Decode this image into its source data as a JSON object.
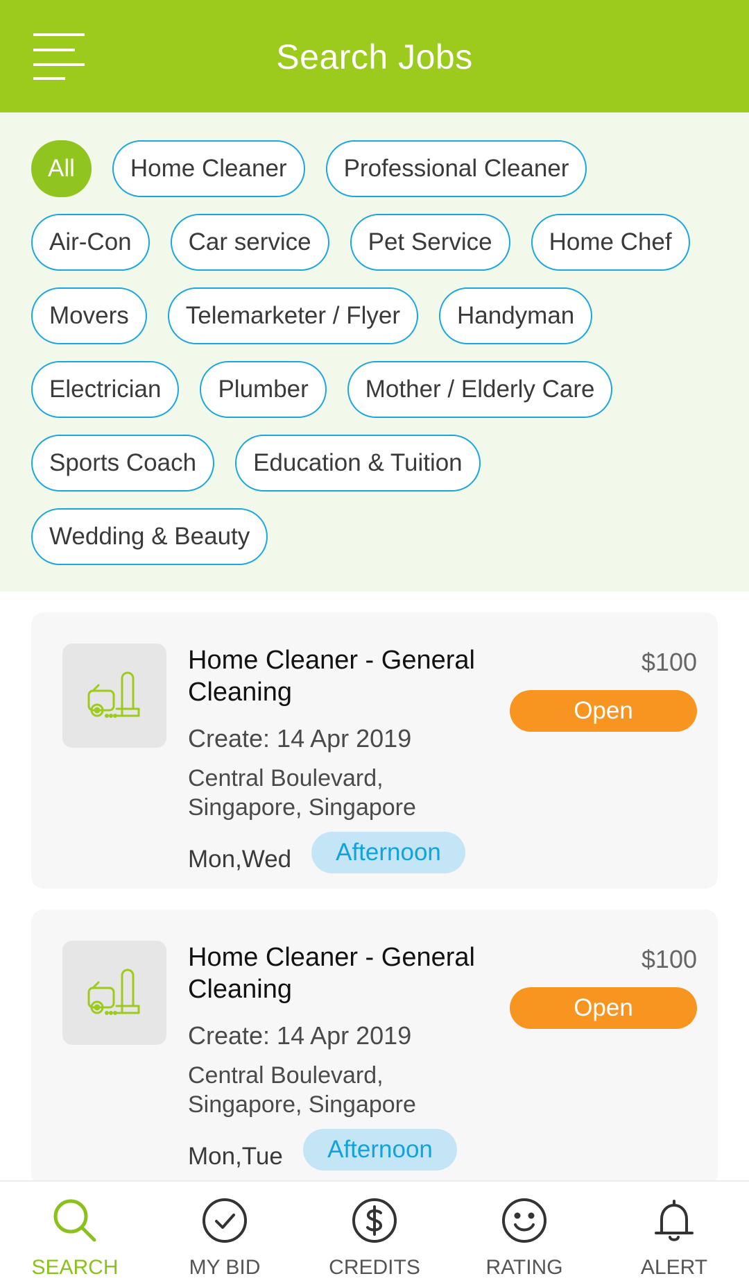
{
  "header": {
    "title": "Search Jobs",
    "menu_icon": "hamburger-menu-icon",
    "background_color": "#9dcb1d"
  },
  "filters": {
    "active": "All",
    "rows": [
      [
        "All",
        "Home Cleaner",
        "Professional Cleaner"
      ],
      [
        "Air-Con",
        "Car service",
        "Pet Service",
        "Home Chef"
      ],
      [
        "Movers",
        "Telemarketer / Flyer",
        "Handyman"
      ],
      [
        "Electrician",
        "Plumber",
        "Mother / Elderly Care"
      ],
      [
        "Sports Coach",
        "Education & Tuition"
      ],
      [
        "Wedding & Beauty"
      ]
    ],
    "accent_color": "#1aa7de",
    "active_color": "#90c41f"
  },
  "jobs": [
    {
      "icon": "vacuum-cleaner-icon",
      "title": "Home Cleaner - General Cleaning",
      "created": "Create: 14 Apr 2019",
      "location": "Central Boulevard, Singapore, Singapore",
      "days": "Mon,Wed",
      "time": "Afternoon",
      "price": "$100",
      "status": "Open"
    },
    {
      "icon": "vacuum-cleaner-icon",
      "title": "Home Cleaner - General Cleaning",
      "created": "Create: 14 Apr 2019",
      "location": "Central Boulevard, Singapore, Singapore",
      "days": "Mon,Tue",
      "time": "Afternoon",
      "price": "$100",
      "status": "Open"
    }
  ],
  "nav": {
    "active": "SEARCH",
    "items": [
      {
        "label": "SEARCH",
        "icon": "search-icon"
      },
      {
        "label": "MY BID",
        "icon": "check-circle-icon"
      },
      {
        "label": "CREDITS",
        "icon": "dollar-circle-icon"
      },
      {
        "label": "RATING",
        "icon": "smiley-icon"
      },
      {
        "label": "ALERT",
        "icon": "bell-icon"
      }
    ]
  },
  "colors": {
    "status_open": "#f79520",
    "time_badge_bg": "#c3e5f6",
    "time_badge_text": "#12a2dc",
    "nav_active": "#8bc11c"
  }
}
